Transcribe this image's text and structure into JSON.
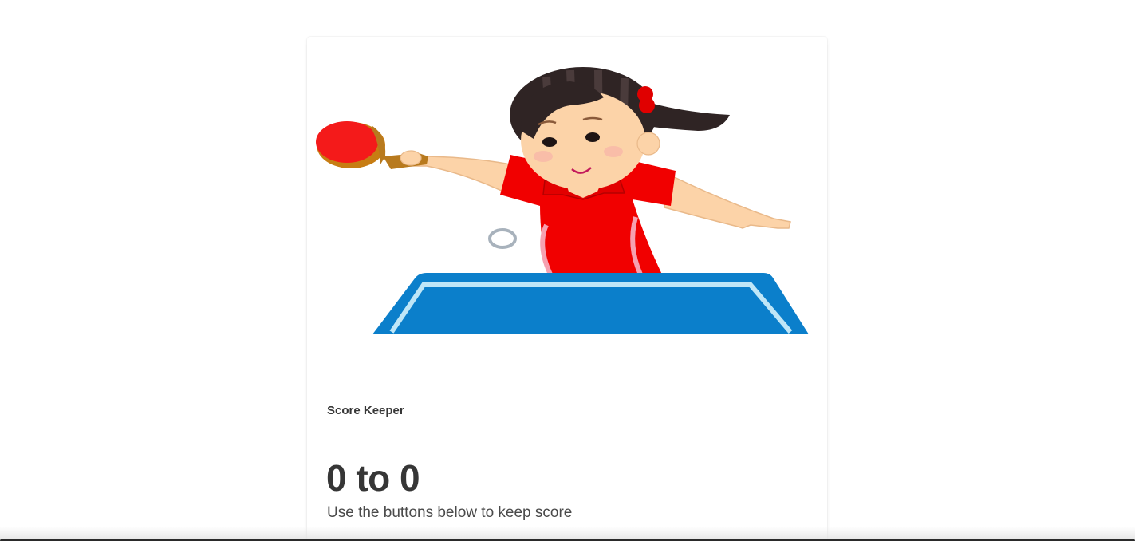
{
  "card": {
    "image_alt": "table-tennis-player-illustration",
    "title": "Score Keeper",
    "score": {
      "player1": 0,
      "separator": "to",
      "player2": 0,
      "display": "0 to 0"
    },
    "subtitle": "Use the buttons below to keep score"
  },
  "colors": {
    "background": "#ffffff",
    "text_dark": "#363636",
    "text_body": "#4a4a4a",
    "table_blue": "#0b7fcb",
    "table_line": "#bfe6f7",
    "shirt_red": "#f10000",
    "paddle_red": "#f41a1a",
    "hair": "#2f2424",
    "skin": "#fcd3a8"
  }
}
